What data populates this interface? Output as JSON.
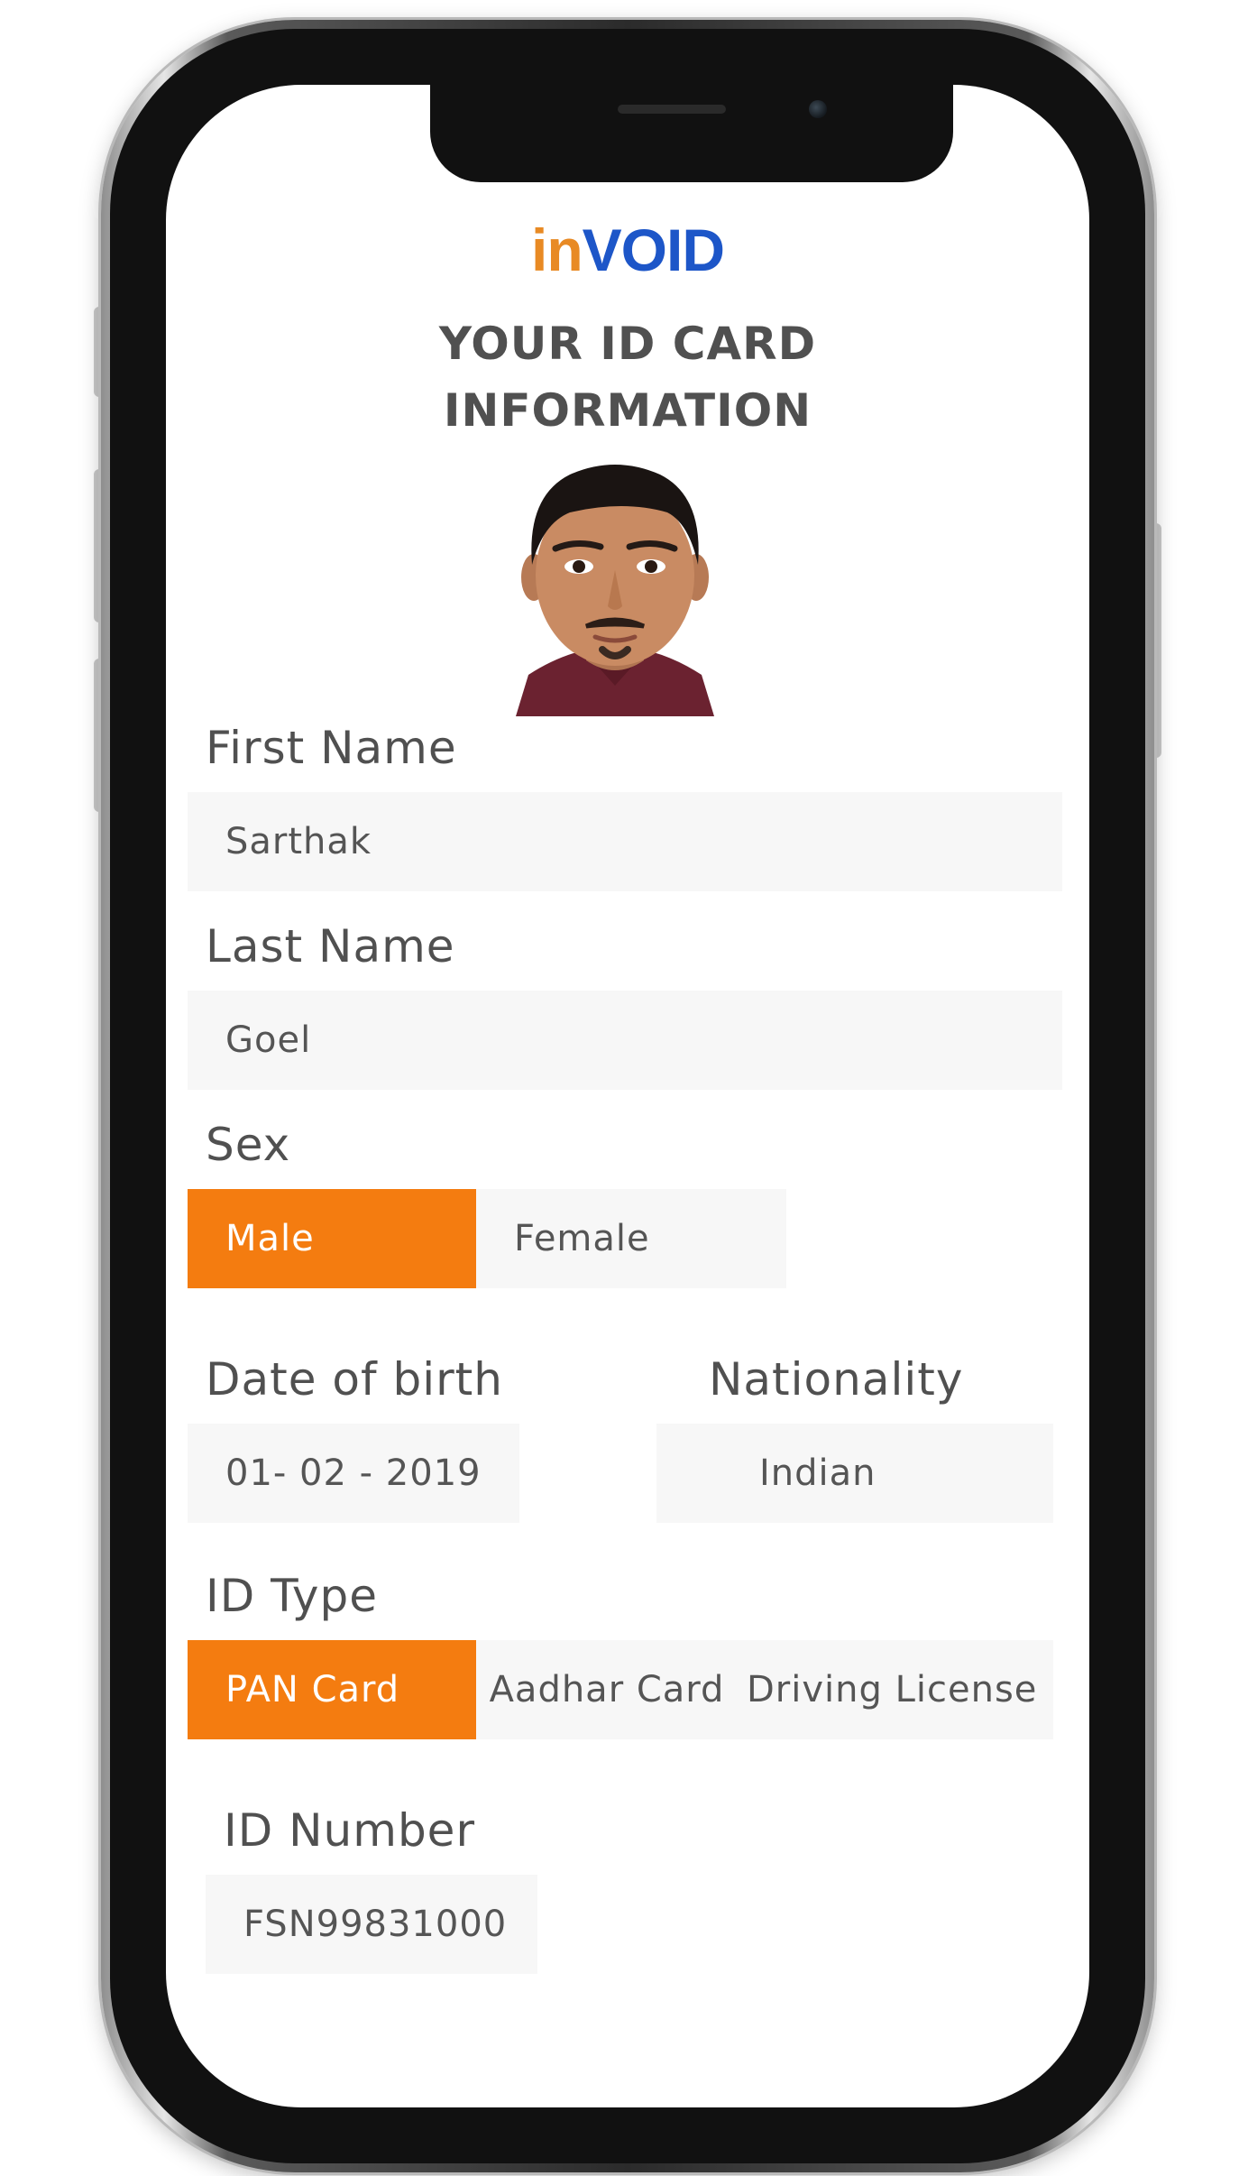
{
  "brand": {
    "prefix": "in",
    "name": "VOID",
    "prefix_color": "#e88a24",
    "name_color": "#1d56c8"
  },
  "title": {
    "line1": "YOUR ID CARD",
    "line2": "INFORMATION"
  },
  "form": {
    "first_name": {
      "label": "First Name",
      "value": "Sarthak"
    },
    "last_name": {
      "label": "Last Name",
      "value": "Goel"
    },
    "sex": {
      "label": "Sex",
      "options": [
        "Male",
        "Female"
      ],
      "selected": "Male"
    },
    "date_of_birth": {
      "label": "Date of birth",
      "value": "01- 02 - 2019"
    },
    "nationality": {
      "label": "Nationality",
      "value": "Indian"
    },
    "id_type": {
      "label": "ID Type",
      "options": [
        "PAN Card",
        "Aadhar Card",
        "Driving License"
      ],
      "selected": "PAN Card"
    },
    "id_number": {
      "label": "ID Number",
      "value": "FSN99831000"
    }
  },
  "colors": {
    "selected": "#f47c10",
    "field_bg": "#f7f7f7",
    "label_text": "#505050"
  }
}
